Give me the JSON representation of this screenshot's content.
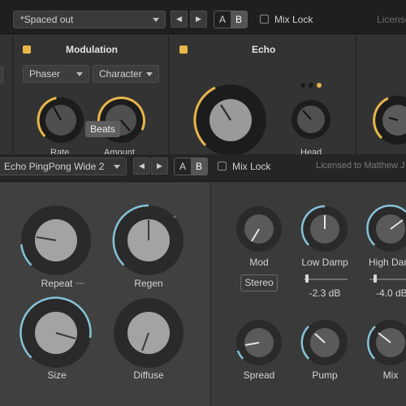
{
  "back_window": {
    "preset": "*Spaced out",
    "prev_icon": "triangle-left",
    "next_icon": "triangle-right",
    "ab": {
      "a": "A",
      "b": "B",
      "active": "B"
    },
    "mix_lock": "Mix Lock",
    "license": "Licensed",
    "modulation": {
      "title": "Modulation",
      "type": "Phaser",
      "character": "Character",
      "knob_labels": [
        "Rate",
        "Amount"
      ]
    },
    "echo": {
      "title": "Echo",
      "knob_label": "Head"
    },
    "led_color": "#e8b54a",
    "accent_color": "#e8b54a"
  },
  "front_window": {
    "preset": "Echo PingPong Wide 2",
    "prev_icon": "triangle-left",
    "next_icon": "triangle-right",
    "ab": {
      "a": "A",
      "b": "B",
      "active": "B"
    },
    "mix_lock": "Mix Lock",
    "license": "Licensed to Matthew J",
    "accent_color": "#86c3d8",
    "left": {
      "repeat": "Repeat",
      "beats": "Beats",
      "regen": "Regen",
      "size": "Size",
      "diffuse": "Diffuse"
    },
    "right": {
      "mod": "Mod",
      "stereo": "Stereo",
      "low_damp": "Low Damp",
      "low_damp_value": "-2.3 dB",
      "high_damp": "High Damp",
      "high_damp_value": "-4.0 dB",
      "spread": "Spread",
      "pump": "Pump",
      "mix": "Mix"
    }
  }
}
